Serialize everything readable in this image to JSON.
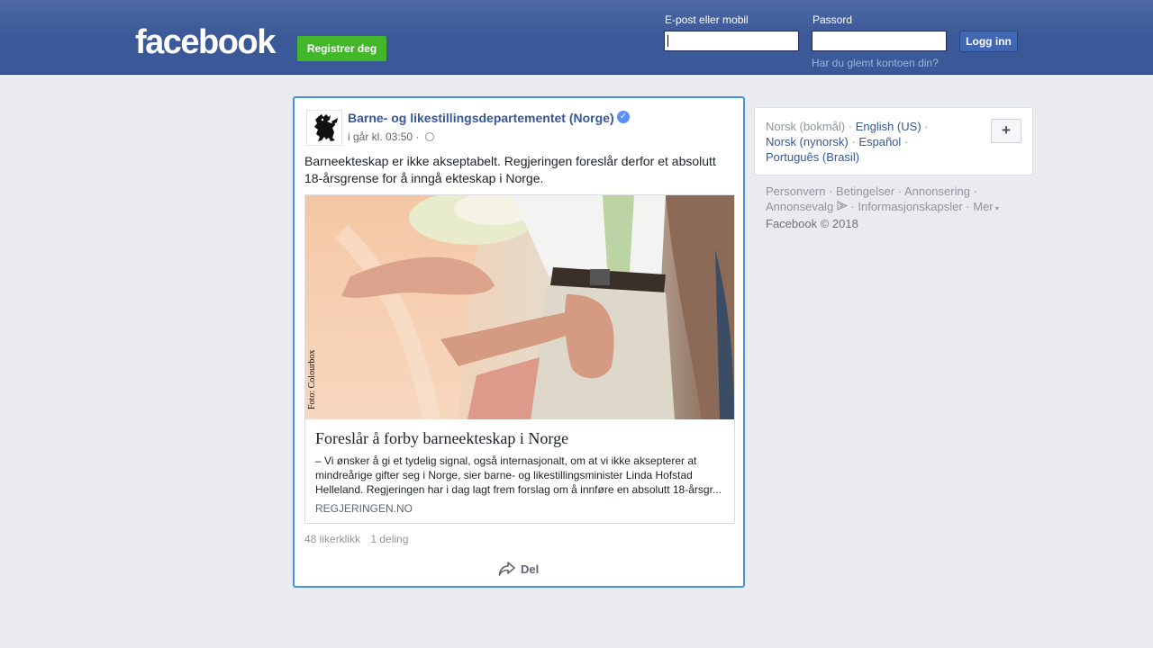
{
  "header": {
    "logo": "facebook",
    "register_label": "Registrer deg",
    "email_label": "E-post eller mobil",
    "password_label": "Passord",
    "login_label": "Logg inn",
    "forgot_label": "Har du glemt kontoen din?",
    "email_value": "",
    "password_value": ""
  },
  "post": {
    "page_name": "Barne- og likestillingsdepartementet (Norge)",
    "verified_icon": "verified-badge-icon",
    "time": "i går kl. 03:50 ·",
    "privacy_icon": "globe-icon",
    "text": "Barneekteskap er ikke akseptabelt. Regjeringen foreslår derfor et absolutt 18-årsgrense for å inngå ekteskap i Norge.",
    "link": {
      "image_credit": "Foto: Colourbox",
      "title": "Foreslår å forby barneekteskap i Norge",
      "description": "– Vi ønsker å gi et tydelig signal, også internasjonalt, om at vi ikke aksepterer at mindreårige gifter seg i Norge, sier barne- og likestillingsminister Linda Hofstad Helleland. Regjeringen har i dag lagt frem forslag om å innføre en absolutt 18-årsgr...",
      "domain": "REGJERINGEN.NO"
    },
    "likes": "48 likerklikk",
    "shares": "1 deling",
    "share_label": "Del",
    "share_icon": "share-arrow-icon"
  },
  "languages": {
    "current": "Norsk (bokmål)",
    "items": [
      "English (US)",
      "Norsk (nynorsk)",
      "Español",
      "Português (Brasil)"
    ],
    "plus_label": "+"
  },
  "footer": {
    "links": [
      "Personvern",
      "Betingelser",
      "Annonsering",
      "Annonsevalg",
      "Informasjonskapsler",
      "Mer"
    ],
    "copyright": "Facebook © 2018"
  },
  "colors": {
    "brand": "#3b5998",
    "link": "#365899",
    "register_green": "#42b72a",
    "post_highlight": "#4a90e2"
  }
}
